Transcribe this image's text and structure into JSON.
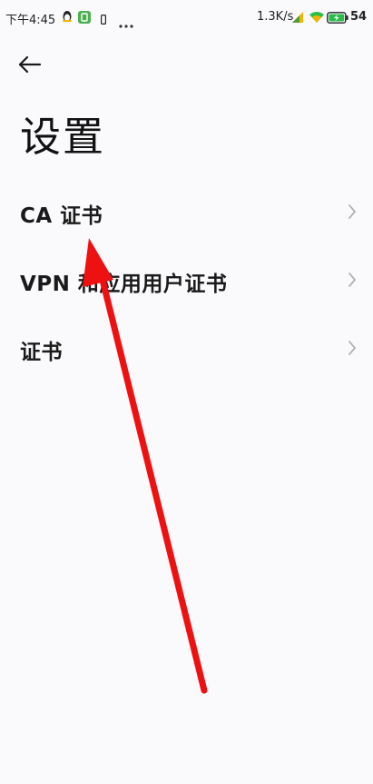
{
  "status_bar": {
    "time": "下午4:45",
    "net_speed": "1.3K/s",
    "battery": "54"
  },
  "header": {
    "title": "设置"
  },
  "items": [
    {
      "label": "CA 证书"
    },
    {
      "label": "VPN 和应用用户证书"
    },
    {
      "label": "证书"
    }
  ],
  "colors": {
    "background": "#fafafd",
    "annotation": "#ee1111",
    "battery_fill": "#2bbd4a"
  }
}
